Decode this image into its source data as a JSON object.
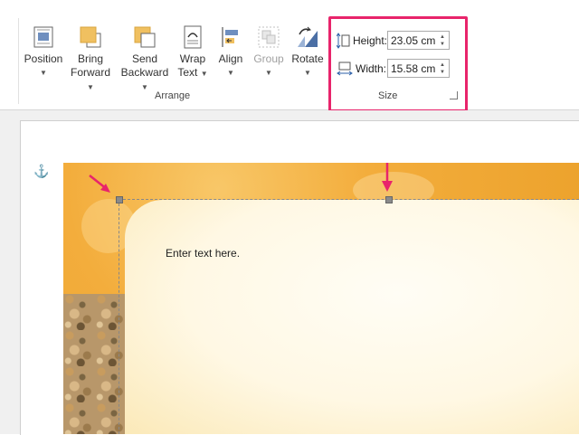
{
  "ribbon": {
    "buttons": {
      "position": {
        "label": "Position",
        "sub": ""
      },
      "bring_forward": {
        "label": "Bring",
        "sub": "Forward"
      },
      "send_backward": {
        "label": "Send",
        "sub": "Backward"
      },
      "wrap_text": {
        "label": "Wrap",
        "sub": "Text"
      },
      "align": {
        "label": "Align",
        "sub": ""
      },
      "group": {
        "label": "Group",
        "sub": ""
      },
      "rotate": {
        "label": "Rotate",
        "sub": ""
      }
    },
    "arrange_label": "Arrange",
    "size": {
      "label": "Size",
      "height_label": "Height:",
      "height_value": "23.05 cm",
      "width_label": "Width:",
      "width_value": "15.58 cm"
    }
  },
  "document": {
    "body_text": "Enter text here."
  },
  "colors": {
    "highlight": "#e8246b",
    "banner": "#f3ad3c"
  }
}
